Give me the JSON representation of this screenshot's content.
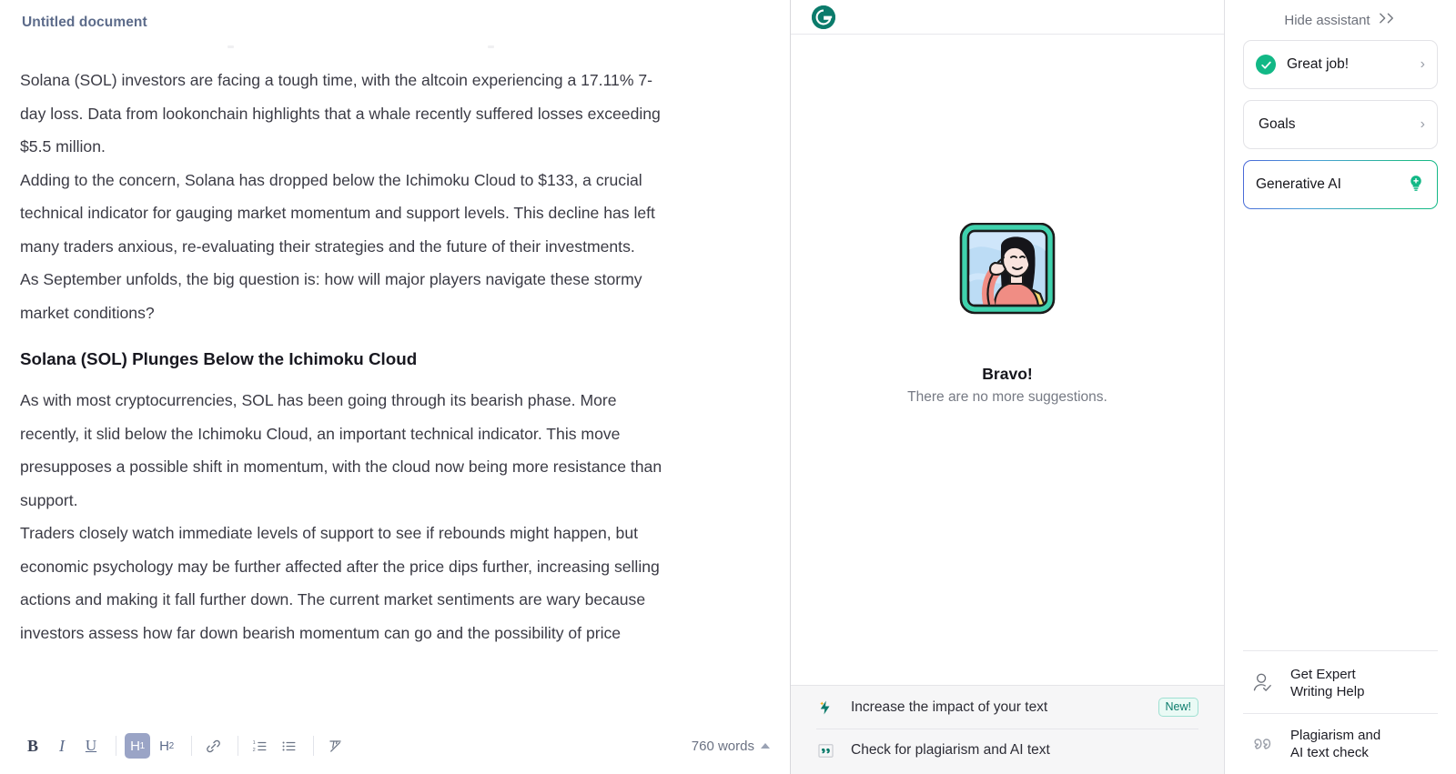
{
  "document": {
    "title": "Untitled document",
    "paragraphs": [
      "Solana (SOL) investors are facing a tough time, with the altcoin experiencing a 17.11% 7-day loss. Data from lookonchain highlights that a whale recently suffered losses exceeding $5.5 million.",
      "Adding to the concern, Solana has dropped below the Ichimoku Cloud to $133, a crucial technical indicator for gauging market momentum and support levels. This decline has left many traders anxious, re-evaluating their strategies and the future of their investments.",
      "As September unfolds, the big question is: how will major players navigate these stormy market conditions?"
    ],
    "heading": "Solana (SOL) Plunges Below the Ichimoku Cloud",
    "paragraphs2": [
      "As with most cryptocurrencies, SOL has been going through its bearish phase. More recently, it slid below the Ichimoku Cloud, an important technical indicator. This move presupposes a possible shift in momentum, with the cloud now being more resistance than support.",
      "Traders closely watch immediate levels of support to see if rebounds might happen, but economic psychology may be further affected after the price dips further, increasing selling actions and making it fall further down. The current market sentiments are wary because investors assess how far down bearish momentum can go and the possibility of price"
    ]
  },
  "toolbar": {
    "bold": "B",
    "italic": "I",
    "underline": "U",
    "h1": "H",
    "h1_sub": "1",
    "h2": "H",
    "h2_sub": "2",
    "link_icon": "link-icon",
    "ordered_list_icon": "ordered-list-icon",
    "bullet_list_icon": "bullet-list-icon",
    "clear_format_icon": "clear-formatting-icon",
    "word_count": "760 words"
  },
  "assistant": {
    "logo": "grammarly-logo",
    "empty_state": {
      "illustration": "mona-lisa-salute-illustration",
      "title": "Bravo!",
      "subtitle": "There are no more suggestions."
    },
    "footer_items": [
      {
        "icon": "lightning-bolt-icon",
        "label": "Increase the impact of your text",
        "badge": "New!"
      },
      {
        "icon": "quote-marks-icon",
        "label": "Check for plagiarism and AI text",
        "badge": ""
      }
    ]
  },
  "sidebar": {
    "hide_label": "Hide assistant",
    "hide_icon": "double-chevron-right-icon",
    "cards": [
      {
        "icon": "check-circle-icon",
        "label": "Great job!",
        "chevron": "›"
      },
      {
        "icon": "",
        "label": "Goals",
        "chevron": "›"
      },
      {
        "icon": "lightbulb-plus-icon",
        "label": "Generative AI",
        "chevron": ""
      }
    ],
    "footer_items": [
      {
        "icon": "person-check-icon",
        "line1": "Get Expert",
        "line2": "Writing Help"
      },
      {
        "icon": "quote-marks-icon",
        "line1": "Plagiarism and",
        "line2": "AI text check"
      }
    ]
  },
  "colors": {
    "brand_green": "#0b7b6b",
    "accent_green": "#12b886",
    "title_blue": "#5c6b8a",
    "h1_active_bg": "#9aa4c6"
  }
}
